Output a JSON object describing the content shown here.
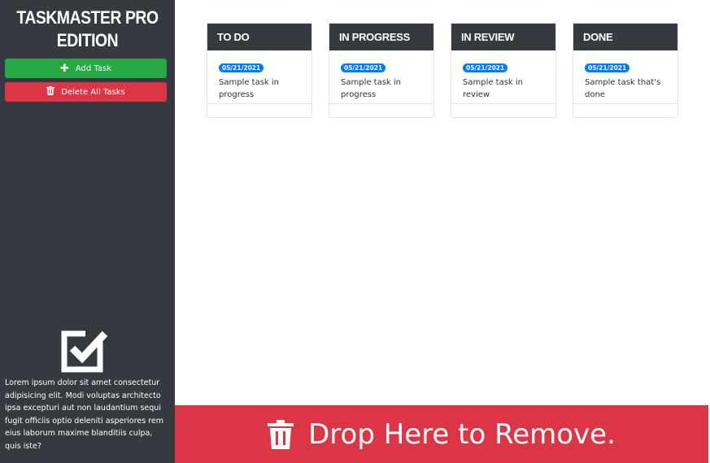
{
  "sidebar": {
    "title": "Taskmaster Pro Edition",
    "add_label": "Add Task",
    "delete_label": "Delete All Tasks",
    "about": "Lorem ipsum dolor sit amet consectetur adipisicing elit. Modi voluptas architecto ipsa excepturi aut non laudantium sequi fugit officiis optio deleniti asperiores rem eius laborum maxime blanditiis culpa, quis iste?"
  },
  "columns": [
    {
      "title": "To Do",
      "task": {
        "date": "05/21/2021",
        "text": "Sample task in progress"
      }
    },
    {
      "title": "In Progress",
      "task": {
        "date": "05/21/2021",
        "text": "Sample task in progress"
      }
    },
    {
      "title": "In Review",
      "task": {
        "date": "05/21/2021",
        "text": "Sample task in review"
      }
    },
    {
      "title": "Done",
      "task": {
        "date": "05/21/2021",
        "text": "Sample task that's done"
      }
    }
  ],
  "drop_zone": {
    "label": "Drop Here to Remove."
  },
  "icons": {
    "add": "plus-icon",
    "delete": "trash-icon",
    "logo": "checkbox-icon",
    "drop": "trash-icon"
  },
  "colors": {
    "sidebar": "#343a40",
    "add": "#28a745",
    "danger": "#dc3545",
    "badge": "#007bff"
  }
}
